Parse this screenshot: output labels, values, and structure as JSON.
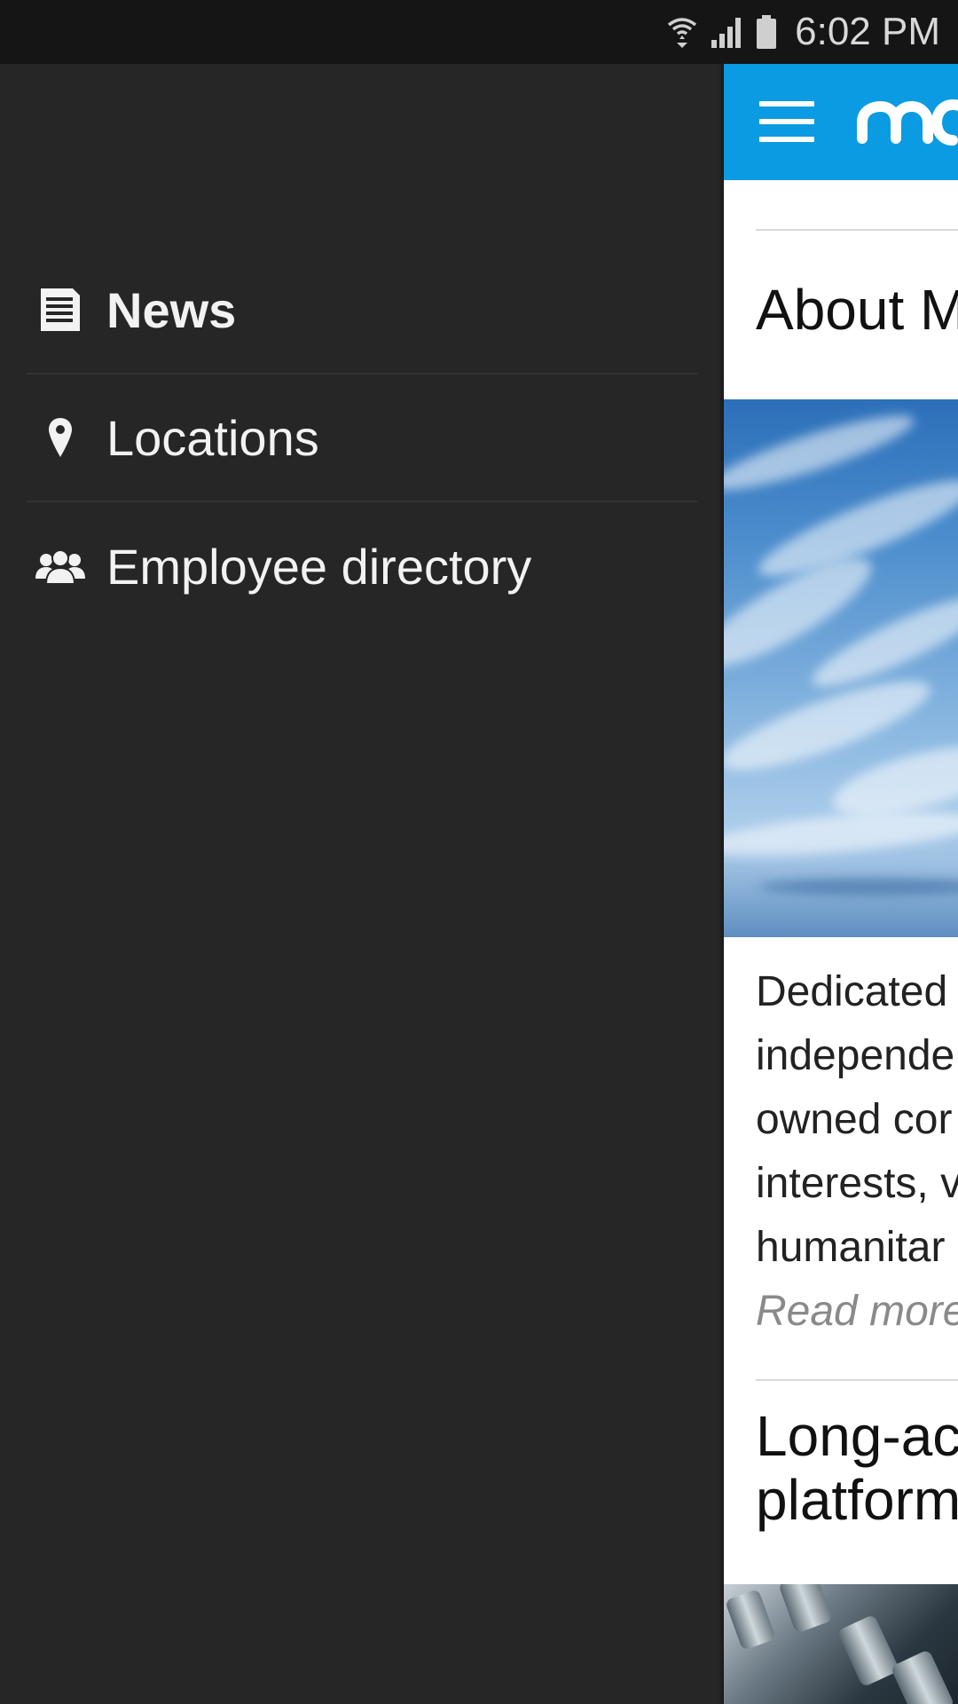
{
  "status_bar": {
    "time": "6:02 PM",
    "icons": [
      "wifi-icon",
      "signal-icon",
      "battery-icon"
    ]
  },
  "drawer": {
    "items": [
      {
        "label": "News",
        "icon": "news-icon",
        "active": true
      },
      {
        "label": "Locations",
        "icon": "location-pin-icon",
        "active": false
      },
      {
        "label": "Employee directory",
        "icon": "people-icon",
        "active": false
      }
    ]
  },
  "content": {
    "appbar": {
      "menu_icon": "hamburger-menu-icon",
      "logo": "brand-logo",
      "color": "#0a9be2"
    },
    "article1": {
      "title": "About M",
      "excerpt_lines": [
        "Dedicated",
        "independe",
        "owned cor",
        "interests, v",
        "humanitar"
      ],
      "read_more": "Read more"
    },
    "article2": {
      "title_lines": [
        "Long-ac",
        "platform"
      ]
    }
  },
  "colors": {
    "drawer_bg": "#262626",
    "status_bar_bg": "#151515",
    "accent": "#0a9be2"
  }
}
